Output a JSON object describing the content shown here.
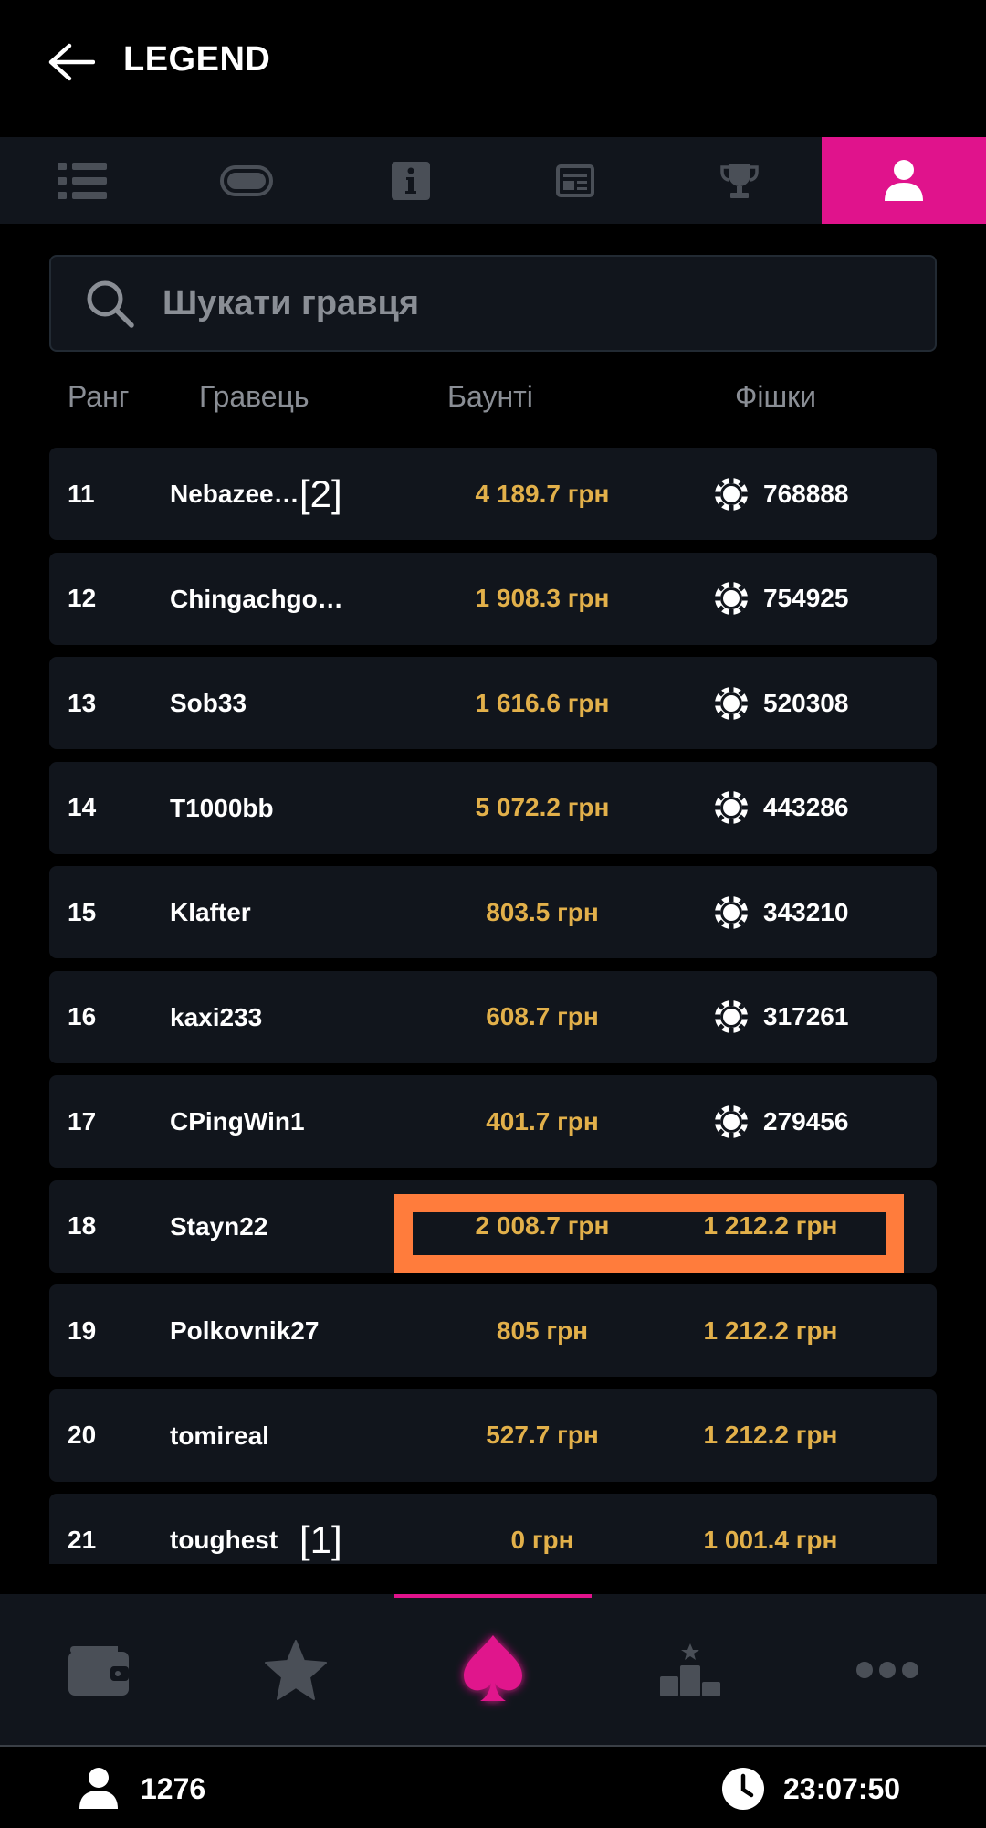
{
  "header": {
    "title": "LEGEND"
  },
  "tabs": [
    {
      "icon": "list-icon"
    },
    {
      "icon": "pill-icon"
    },
    {
      "icon": "info-icon"
    },
    {
      "icon": "news-icon"
    },
    {
      "icon": "trophy-icon"
    },
    {
      "icon": "user-icon",
      "active": true
    }
  ],
  "search": {
    "placeholder": "Шукати гравця"
  },
  "columns": {
    "rank": "Ранг",
    "player": "Гравець",
    "bounty": "Баунті",
    "chips": "Фішки"
  },
  "rows": [
    {
      "rank": "11",
      "player": "Nebazee…",
      "bounty": "4 189.7 грн",
      "chips": "768888",
      "chip_icon": true,
      "tag": "[2]"
    },
    {
      "rank": "12",
      "player": "Chingachgo…",
      "bounty": "1 908.3 грн",
      "chips": "754925",
      "chip_icon": true
    },
    {
      "rank": "13",
      "player": "Sob33",
      "bounty": "1 616.6 грн",
      "chips": "520308",
      "chip_icon": true
    },
    {
      "rank": "14",
      "player": "T1000bb",
      "bounty": "5 072.2 грн",
      "chips": "443286",
      "chip_icon": true
    },
    {
      "rank": "15",
      "player": "Klafter",
      "bounty": "803.5 грн",
      "chips": "343210",
      "chip_icon": true
    },
    {
      "rank": "16",
      "player": "kaxi233",
      "bounty": "608.7 грн",
      "chips": "317261",
      "chip_icon": true
    },
    {
      "rank": "17",
      "player": "CPingWin1",
      "bounty": "401.7 грн",
      "chips": "279456",
      "chip_icon": true
    },
    {
      "rank": "18",
      "player": "Stayn22",
      "bounty": "2 008.7 грн",
      "chips": "1 212.2 грн",
      "chip_icon": false
    },
    {
      "rank": "19",
      "player": "Polkovnik27",
      "bounty": "805 грн",
      "chips": "1 212.2 грн",
      "chip_icon": false
    },
    {
      "rank": "20",
      "player": "tomireal",
      "bounty": "527.7 грн",
      "chips": "1 212.2 грн",
      "chip_icon": false
    },
    {
      "rank": "21",
      "player": "toughest",
      "bounty": "0 грн",
      "chips": "1 001.4 грн",
      "chip_icon": false,
      "tag": "[1]"
    }
  ],
  "bottom_nav": [
    {
      "icon": "wallet-icon"
    },
    {
      "icon": "star-icon"
    },
    {
      "icon": "spade-icon",
      "active": true
    },
    {
      "icon": "leaderboard-icon"
    },
    {
      "icon": "more-icon"
    }
  ],
  "status": {
    "online_users": "1276",
    "time": "23:07:50"
  },
  "colors": {
    "accent": "#e0138c",
    "money": "#e2b04a",
    "highlight": "#ff7c3c",
    "row_bg": "#11151c"
  }
}
